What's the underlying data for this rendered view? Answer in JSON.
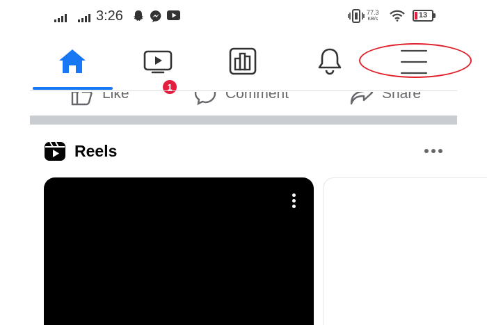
{
  "status_bar": {
    "time": "3:26",
    "net_speed_value": "77.3",
    "net_speed_unit": "KB/s",
    "battery": "13",
    "notification_icons": [
      "snapchat-icon",
      "messenger-icon",
      "youtube-icon"
    ],
    "system_icons": [
      "vibrate-icon",
      "wifi-icon",
      "battery-icon"
    ]
  },
  "nav": {
    "items": [
      {
        "name": "home",
        "icon": "home-icon",
        "active": true
      },
      {
        "name": "watch",
        "icon": "video-icon",
        "badge": "1"
      },
      {
        "name": "marketplace",
        "icon": "storefront-icon"
      },
      {
        "name": "notifications",
        "icon": "bell-icon"
      },
      {
        "name": "menu",
        "icon": "hamburger-menu-icon"
      }
    ],
    "accent_color": "#1877f2",
    "badge_color": "#e41e3f",
    "annotation_color": "#e0202a"
  },
  "post_actions": {
    "like": "Like",
    "comment": "Comment",
    "share": "Share"
  },
  "reels": {
    "title": "Reels",
    "icon": "reels-icon"
  }
}
